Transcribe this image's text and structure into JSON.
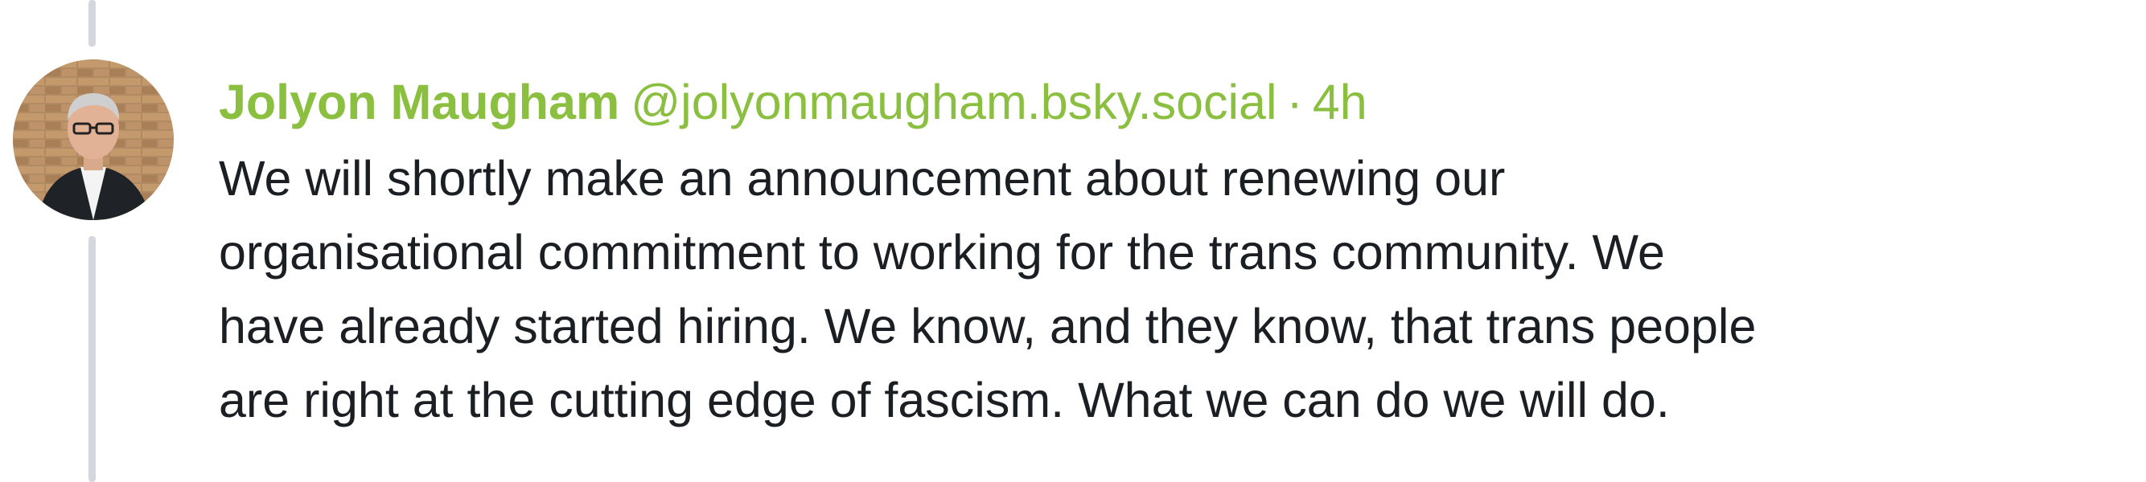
{
  "post": {
    "author_name": "Jolyon Maugham",
    "author_handle": "@jolyonmaugham.bsky.social",
    "separator": "·",
    "time": "4h",
    "text_lines": [
      "We will shortly make an announcement about renewing our",
      "organisational commitment to working for the trans community. We",
      "have already started hiring. We know, and they know, that trans people",
      "are right at the cutting edge of fascism. What we can do we will do."
    ],
    "avatar_icon": "person-photo"
  },
  "colors": {
    "accent": "#8bbf3f",
    "text": "#1b1f23",
    "thread_line": "#d4d8de"
  }
}
